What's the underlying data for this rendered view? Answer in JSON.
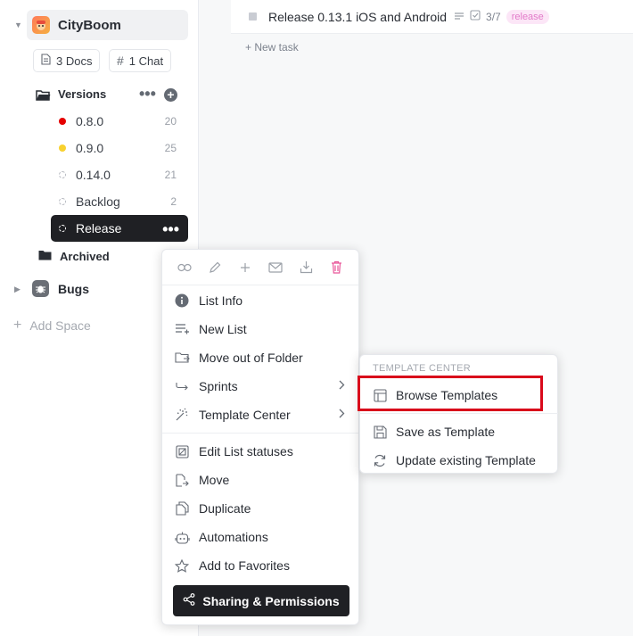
{
  "task": {
    "name": "Release 0.13.1 iOS and Android",
    "checklist": "3/7",
    "tag": "release",
    "new_task_label": "+ New task"
  },
  "sidebar": {
    "space_name": "CityBoom",
    "docs_chip": "3 Docs",
    "chat_chip": "1 Chat",
    "folder_versions": "Versions",
    "lists": [
      {
        "label": "0.8.0",
        "count": "20",
        "color": "#e50000"
      },
      {
        "label": "0.9.0",
        "count": "25",
        "color": "#f8d12f"
      },
      {
        "label": "0.14.0",
        "count": "21",
        "color": ""
      },
      {
        "label": "Backlog",
        "count": "2",
        "color": ""
      },
      {
        "label": "Release",
        "count": "",
        "color": ""
      }
    ],
    "folder_archived": "Archived",
    "space_bugs": "Bugs",
    "add_space": "Add Space"
  },
  "context_menu": {
    "items": [
      {
        "label": "List Info",
        "icon": "info-icon"
      },
      {
        "label": "New List",
        "icon": "new-list-icon"
      },
      {
        "label": "Move out of Folder",
        "icon": "folder-out-icon"
      },
      {
        "label": "Sprints",
        "icon": "sprint-icon"
      },
      {
        "label": "Template Center",
        "icon": "magic-wand-icon"
      },
      {
        "label": "Edit List statuses",
        "icon": "status-icon"
      },
      {
        "label": "Move",
        "icon": "move-icon"
      },
      {
        "label": "Duplicate",
        "icon": "duplicate-icon"
      },
      {
        "label": "Automations",
        "icon": "robot-icon"
      },
      {
        "label": "Add to Favorites",
        "icon": "star-icon"
      }
    ],
    "share_button": "Sharing & Permissions"
  },
  "submenu": {
    "heading": "TEMPLATE CENTER",
    "items": [
      {
        "label": "Browse Templates",
        "icon": "template-icon"
      },
      {
        "label": "Save as Template",
        "icon": "save-icon"
      },
      {
        "label": "Update existing Template",
        "icon": "refresh-icon"
      }
    ]
  },
  "colors": {
    "highlight": "#d9091b",
    "dark": "#1f2024",
    "tag_bg": "#fce6f7",
    "tag_fg": "#e27ac9"
  }
}
